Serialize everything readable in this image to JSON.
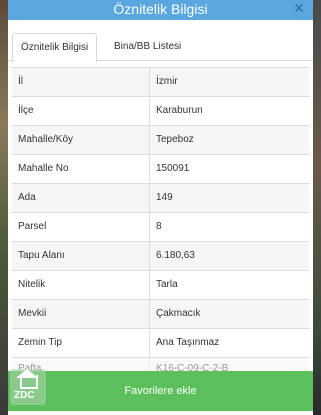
{
  "header": {
    "title": "Öznitelik Bilgisi",
    "close_glyph": "✕"
  },
  "tabs": [
    {
      "label": "Öznitelik Bilgisi",
      "active": true
    },
    {
      "label": "Bina/BB Listesi",
      "active": false
    }
  ],
  "rows": [
    {
      "key": "İl",
      "value": "İzmir"
    },
    {
      "key": "İlçe",
      "value": "Karaburun"
    },
    {
      "key": "Mahalle/Köy",
      "value": "Tepeboz"
    },
    {
      "key": "Mahalle No",
      "value": "150091"
    },
    {
      "key": "Ada",
      "value": "149"
    },
    {
      "key": "Parsel",
      "value": "8"
    },
    {
      "key": "Tapu Alanı",
      "value": "6.180,63"
    },
    {
      "key": "Nitelik",
      "value": "Tarla"
    },
    {
      "key": "Mevkii",
      "value": "Çakmacık"
    },
    {
      "key": "Zemin Tip",
      "value": "Ana Taşınmaz"
    },
    {
      "key": "Pafta",
      "value": "K16-C-09-C-2-B"
    }
  ],
  "footer": {
    "button_label": "Favorilere ekle"
  },
  "logo": {
    "text": "ZDC"
  },
  "colors": {
    "header": "#5aa7e0",
    "button": "#5bbf5b"
  }
}
